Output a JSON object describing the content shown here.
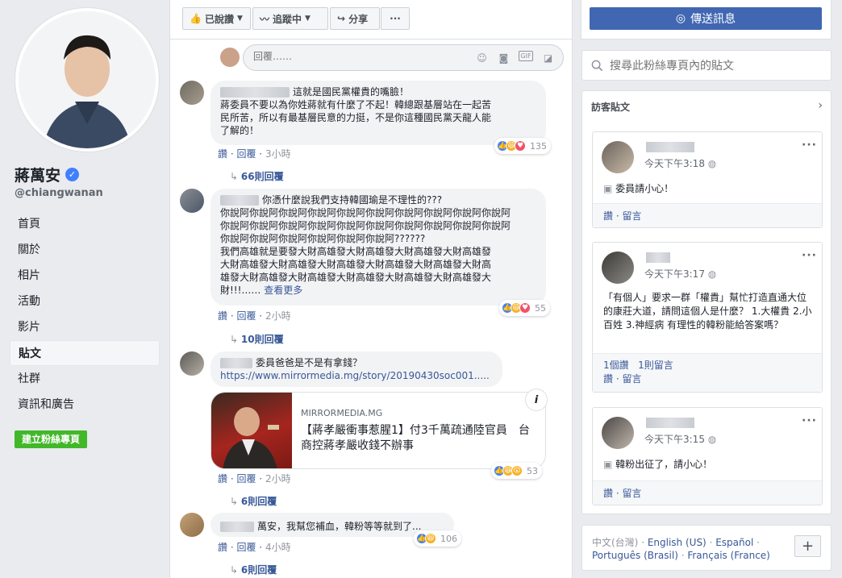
{
  "page": {
    "name": "蔣萬安",
    "handle": "@chiangwanan",
    "verified_icon": "verified-badge-icon"
  },
  "nav": {
    "items": [
      "首頁",
      "關於",
      "相片",
      "活動",
      "影片",
      "貼文",
      "社群",
      "資訊和廣告"
    ],
    "active": "貼文",
    "create_button": "建立粉絲專頁"
  },
  "toolbar": {
    "liked_label": "已說讚",
    "following_label": "追蹤中",
    "share_label": "分享",
    "more_label": "···"
  },
  "reply_box": {
    "placeholder": "回覆……"
  },
  "comments": [
    {
      "text_lines": [
        "這就是國民黨權貴的嘴臉！",
        "蔣委員不要以為你姓蔣就有什麼了不起！韓總跟基層站在一起苦",
        "民所苦，所以有最基層民意的力挺，不是你這種國民黨天龍人能",
        "了解的！"
      ],
      "like": "讚",
      "reply": "回覆",
      "time": "3小時",
      "reactions": "135",
      "replies": "66則回覆"
    },
    {
      "text_lines": [
        "你憑什麼說我們支持韓國瑜是不理性的???",
        "你說阿你說阿你說阿你說阿你說阿你說阿你說阿你說阿你說阿你說阿",
        "你說阿你說阿你說阿你說阿你說阿你說阿你說阿你說阿你說阿你說阿",
        "你說阿你說阿你說阿你說阿你說阿你說阿??????",
        "我們高雄就是要發大財高雄發大財高雄發大財高雄發大財高雄發",
        "大財高雄發大財高雄發大財高雄發大財高雄發大財高雄發大財高",
        "雄發大財高雄發大財高雄發大財高雄發大財高雄發大財高雄發大",
        "財!!!……"
      ],
      "see_more": "查看更多",
      "like": "讚",
      "reply": "回覆",
      "time": "2小時",
      "reactions": "55",
      "replies": "10則回覆"
    },
    {
      "text_lines": [
        "委員爸爸是不是有拿錢？",
        "https://www.mirrormedia.mg/story/20190430soc001....."
      ],
      "link_source": "MIRRORMEDIA.MG",
      "link_title": "【蔣孝嚴衝事惹腥1】付3千萬疏通陸官員　台商控蔣孝嚴收錢不辦事",
      "like": "讚",
      "reply": "回覆",
      "time": "2小時",
      "reactions": "53",
      "replies": "6則回覆"
    },
    {
      "text_lines": [
        "萬安，我幫您補血，韓粉等等就到了..."
      ],
      "like": "讚",
      "reply": "回覆",
      "time": "4小時",
      "reactions": "106",
      "replies": "6則回覆"
    }
  ],
  "right": {
    "message_button": "傳送訊息",
    "search_placeholder": "搜尋此粉絲專頁內的貼文",
    "visitor_title": "訪客貼文",
    "visitor_posts": [
      {
        "time": "今天下午3:18",
        "text": "委員請小心！",
        "like": "讚",
        "comment": "留言"
      },
      {
        "time": "今天下午3:17",
        "text": "「有個人」要求一群「權貴」幫忙打造直通大位的康莊大道，請問這個人是什麼？ 1.大權貴 2.小百姓 3.神經病 有理性的韓粉能給答案嗎？",
        "stats_like": "1個讚",
        "stats_comment": "1則留言",
        "like": "讚",
        "comment": "留言"
      },
      {
        "time": "今天下午3:15",
        "text": "韓粉出征了，請小心！",
        "like": "讚",
        "comment": "留言"
      }
    ],
    "languages_line1": [
      "中文(台灣)",
      "English (US)",
      "Español"
    ],
    "languages_line2": [
      "Português (Brasil)",
      "Français (France)"
    ],
    "plus": "+"
  }
}
